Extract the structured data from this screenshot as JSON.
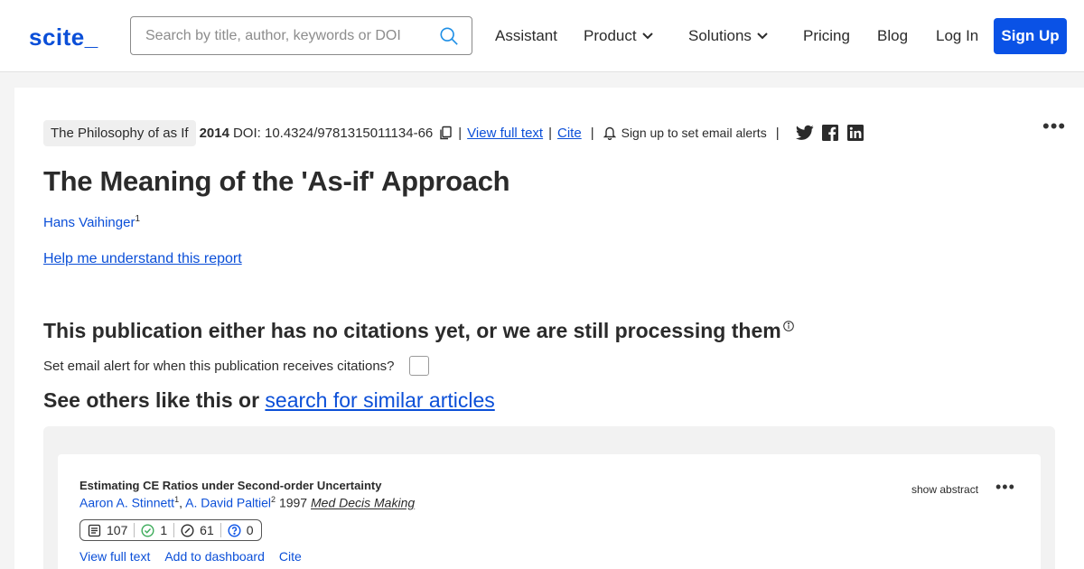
{
  "nav": {
    "logo": "scite_",
    "search_placeholder": "Search by title, author, keywords or DOI",
    "links": {
      "assistant": "Assistant",
      "product": "Product",
      "solutions": "Solutions",
      "pricing": "Pricing",
      "blog": "Blog",
      "login": "Log In",
      "signup": "Sign Up"
    }
  },
  "paper": {
    "journal": "The Philosophy of as If",
    "year": "2014",
    "doi": "DOI: 10.4324/9781315011134-66",
    "view_full_text": "View full text",
    "cite": "Cite",
    "sep": "|",
    "alerts": "Sign up to set email alerts",
    "title": "The Meaning of the 'As-if' Approach",
    "author": "Hans Vaihinger",
    "author_sup": "1",
    "help": "Help me understand this report",
    "more": "•••"
  },
  "citations": {
    "no_citations": "This publication either has no citations yet, or we are still processing them",
    "email_alert": "Set email alert for when this publication receives citations?",
    "see_others": "See others like this or ",
    "search_similar": "search for similar articles"
  },
  "results": [
    {
      "title": "Estimating CE Ratios under Second-order Uncertainty",
      "authors": [
        {
          "name": "Aaron A. Stinnett",
          "sup": "1"
        },
        {
          "name": "A. David Paltiel",
          "sup": "2"
        }
      ],
      "author_sep": ", ",
      "year": "1997",
      "journal": "Med Decis Making",
      "show_abstract": "show abstract",
      "more": "•••",
      "tally": {
        "publications": "107",
        "supporting": "1",
        "mentioning": "61",
        "contrasting": "0"
      },
      "actions": {
        "view": "View full text",
        "dashboard": "Add to dashboard",
        "cite": "Cite"
      }
    }
  ],
  "colors": {
    "accent": "#0a52e6",
    "link": "#0b4fd8",
    "text": "#2b2b2b",
    "supporting": "#3cab5a"
  }
}
